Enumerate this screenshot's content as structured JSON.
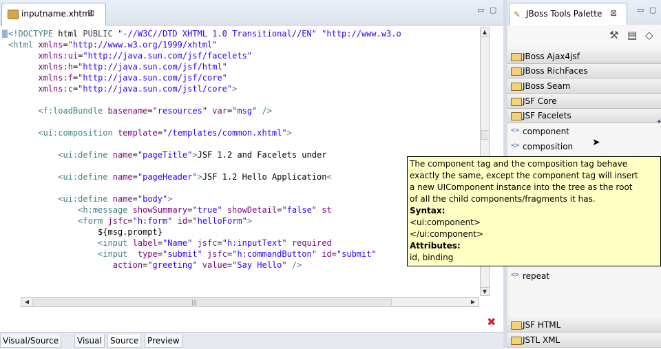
{
  "editor": {
    "tab_label": "inputname.xhtml",
    "tab_close": "⊠",
    "window_controls": "▭ ▢",
    "code_lines": [
      [
        {
          "c": "t-doc",
          "t": "<!DOCTYPE "
        },
        {
          "c": "t-kw",
          "t": "html"
        },
        {
          "c": "t-grey",
          "t": " PUBLIC "
        },
        {
          "c": "t-val",
          "t": "\"-//W3C//DTD XHTML 1.0 Transitional//EN\""
        },
        {
          "c": "t-val",
          "t": " \"http://www.w3.o"
        }
      ],
      [
        {
          "c": "t-tag",
          "t": "<html "
        },
        {
          "c": "t-attr",
          "t": "xmlns"
        },
        {
          "c": "t-text",
          "t": "="
        },
        {
          "c": "t-val",
          "t": "\"http://www.w3.org/1999/xhtml\""
        }
      ],
      [
        {
          "c": "t-text",
          "t": "      "
        },
        {
          "c": "t-attr",
          "t": "xmlns:ui"
        },
        {
          "c": "t-text",
          "t": "="
        },
        {
          "c": "t-val",
          "t": "\"http://java.sun.com/jsf/facelets\""
        }
      ],
      [
        {
          "c": "t-text",
          "t": "      "
        },
        {
          "c": "t-attr",
          "t": "xmlns:h"
        },
        {
          "c": "t-text",
          "t": "="
        },
        {
          "c": "t-val",
          "t": "\"http://java.sun.com/jsf/html\""
        }
      ],
      [
        {
          "c": "t-text",
          "t": "      "
        },
        {
          "c": "t-attr",
          "t": "xmlns:f"
        },
        {
          "c": "t-text",
          "t": "="
        },
        {
          "c": "t-val",
          "t": "\"http://java.sun.com/jsf/core\""
        }
      ],
      [
        {
          "c": "t-text",
          "t": "      "
        },
        {
          "c": "t-attr",
          "t": "xmlns:c"
        },
        {
          "c": "t-text",
          "t": "="
        },
        {
          "c": "t-val",
          "t": "\"http://java.sun.com/jstl/core\""
        },
        {
          "c": "t-tag",
          "t": ">"
        }
      ],
      [],
      [
        {
          "c": "t-text",
          "t": "      "
        },
        {
          "c": "t-tag",
          "t": "<f:loadBundle "
        },
        {
          "c": "t-attr",
          "t": "basename"
        },
        {
          "c": "t-text",
          "t": "="
        },
        {
          "c": "t-val",
          "t": "\"resources\""
        },
        {
          "c": "t-text",
          "t": " "
        },
        {
          "c": "t-attr",
          "t": "var"
        },
        {
          "c": "t-text",
          "t": "="
        },
        {
          "c": "t-val",
          "t": "\"msg\""
        },
        {
          "c": "t-tag",
          "t": " />"
        }
      ],
      [],
      [
        {
          "c": "t-text",
          "t": "      "
        },
        {
          "c": "t-tag",
          "t": "<ui:composition "
        },
        {
          "c": "t-attr",
          "t": "template"
        },
        {
          "c": "t-text",
          "t": "="
        },
        {
          "c": "t-val",
          "t": "\"/templates/common.xhtml\""
        },
        {
          "c": "t-tag",
          "t": ">"
        }
      ],
      [],
      [
        {
          "c": "t-text",
          "t": "          "
        },
        {
          "c": "t-tag",
          "t": "<ui:define "
        },
        {
          "c": "t-attr",
          "t": "name"
        },
        {
          "c": "t-text",
          "t": "="
        },
        {
          "c": "t-val",
          "t": "\"pageTitle\""
        },
        {
          "c": "t-tag",
          "t": ">"
        },
        {
          "c": "t-text",
          "t": "JSF 1.2 and Facelets under "
        }
      ],
      [],
      [
        {
          "c": "t-text",
          "t": "          "
        },
        {
          "c": "t-tag",
          "t": "<ui:define "
        },
        {
          "c": "t-attr",
          "t": "name"
        },
        {
          "c": "t-text",
          "t": "="
        },
        {
          "c": "t-val",
          "t": "\"pageHeader\""
        },
        {
          "c": "t-tag",
          "t": ">"
        },
        {
          "c": "t-text",
          "t": "JSF 1.2 Hello Application"
        },
        {
          "c": "t-tag",
          "t": "<"
        }
      ],
      [],
      [
        {
          "c": "t-text",
          "t": "          "
        },
        {
          "c": "t-tag",
          "t": "<ui:define "
        },
        {
          "c": "t-attr",
          "t": "name"
        },
        {
          "c": "t-text",
          "t": "="
        },
        {
          "c": "t-val",
          "t": "\"body\""
        },
        {
          "c": "t-tag",
          "t": ">"
        }
      ],
      [
        {
          "c": "t-text",
          "t": "              "
        },
        {
          "c": "t-tag",
          "t": "<h:message "
        },
        {
          "c": "t-attr",
          "t": "showSummary"
        },
        {
          "c": "t-text",
          "t": "="
        },
        {
          "c": "t-val",
          "t": "\"true\""
        },
        {
          "c": "t-text",
          "t": " "
        },
        {
          "c": "t-attr",
          "t": "showDetail"
        },
        {
          "c": "t-text",
          "t": "="
        },
        {
          "c": "t-val",
          "t": "\"false\""
        },
        {
          "c": "t-text",
          "t": " "
        },
        {
          "c": "t-attr",
          "t": "st"
        }
      ],
      [
        {
          "c": "t-text",
          "t": "              "
        },
        {
          "c": "t-tag",
          "t": "<form "
        },
        {
          "c": "t-attr",
          "t": "jsfc"
        },
        {
          "c": "t-text",
          "t": "="
        },
        {
          "c": "t-val",
          "t": "\"h:form\""
        },
        {
          "c": "t-text",
          "t": " "
        },
        {
          "c": "t-attr",
          "t": "id"
        },
        {
          "c": "t-text",
          "t": "="
        },
        {
          "c": "t-val",
          "t": "\"helloForm\""
        },
        {
          "c": "t-tag",
          "t": ">"
        }
      ],
      [
        {
          "c": "t-text",
          "t": "                  ${msg.prompt}"
        }
      ],
      [
        {
          "c": "t-text",
          "t": "                  "
        },
        {
          "c": "t-tag",
          "t": "<input "
        },
        {
          "c": "t-attr",
          "t": "label"
        },
        {
          "c": "t-text",
          "t": "="
        },
        {
          "c": "t-val",
          "t": "\"Name\""
        },
        {
          "c": "t-text",
          "t": " "
        },
        {
          "c": "t-attr",
          "t": "jsfc"
        },
        {
          "c": "t-text",
          "t": "="
        },
        {
          "c": "t-val",
          "t": "\"h:inputText\""
        },
        {
          "c": "t-text",
          "t": " "
        },
        {
          "c": "t-attr",
          "t": "required"
        }
      ],
      [
        {
          "c": "t-text",
          "t": "                  "
        },
        {
          "c": "t-tag",
          "t": "<input  "
        },
        {
          "c": "t-attr",
          "t": "type"
        },
        {
          "c": "t-text",
          "t": "="
        },
        {
          "c": "t-val",
          "t": "\"submit\""
        },
        {
          "c": "t-text",
          "t": " "
        },
        {
          "c": "t-attr",
          "t": "jsfc"
        },
        {
          "c": "t-text",
          "t": "="
        },
        {
          "c": "t-val",
          "t": "\"h:commandButton\""
        },
        {
          "c": "t-text",
          "t": " "
        },
        {
          "c": "t-attr",
          "t": "id"
        },
        {
          "c": "t-text",
          "t": "="
        },
        {
          "c": "t-val",
          "t": "\"submit\""
        }
      ],
      [
        {
          "c": "t-text",
          "t": "                     "
        },
        {
          "c": "t-attr",
          "t": "action"
        },
        {
          "c": "t-text",
          "t": "="
        },
        {
          "c": "t-val",
          "t": "\"greeting\""
        },
        {
          "c": "t-text",
          "t": " "
        },
        {
          "c": "t-attr",
          "t": "value"
        },
        {
          "c": "t-text",
          "t": "="
        },
        {
          "c": "t-val",
          "t": "\"Say Hello\""
        },
        {
          "c": "t-tag",
          "t": " />"
        }
      ]
    ],
    "bottom_tabs": [
      "Visual/Source",
      "Visual",
      "Source",
      "Preview"
    ],
    "active_bottom_tab": "Source"
  },
  "palette": {
    "tab_label": "JBoss Tools Palette",
    "tab_close": "⊠",
    "window_controls": "▭ ▢",
    "groups": [
      {
        "label": "JBoss Ajax4jsf"
      },
      {
        "label": "JBoss RichFaces"
      },
      {
        "label": "JBoss Seam"
      },
      {
        "label": "JSF Core"
      },
      {
        "label": "JSF Facelets"
      }
    ],
    "items": [
      {
        "label": "component"
      },
      {
        "label": "composition"
      }
    ],
    "item_below": {
      "label": "repeat"
    },
    "bottom_groups": [
      {
        "label": "JSF HTML"
      },
      {
        "label": "JSTL XML"
      }
    ]
  },
  "tooltip": {
    "lines": [
      {
        "text": "The component tag and the composition tag behave",
        "bold": false
      },
      {
        "text": " exactly the same, except the component tag will insert",
        "bold": false
      },
      {
        "text": "a new UIComponent instance into the tree as the root",
        "bold": false
      },
      {
        "text": " of all the child components/fragments it has.",
        "bold": false
      },
      {
        "text": "Syntax:",
        "bold": true
      },
      {
        "text": "<ui:component>",
        "bold": false
      },
      {
        "text": "</ui:component>",
        "bold": false
      },
      {
        "text": "Attributes:",
        "bold": true
      },
      {
        "text": "id, binding",
        "bold": false
      }
    ]
  }
}
